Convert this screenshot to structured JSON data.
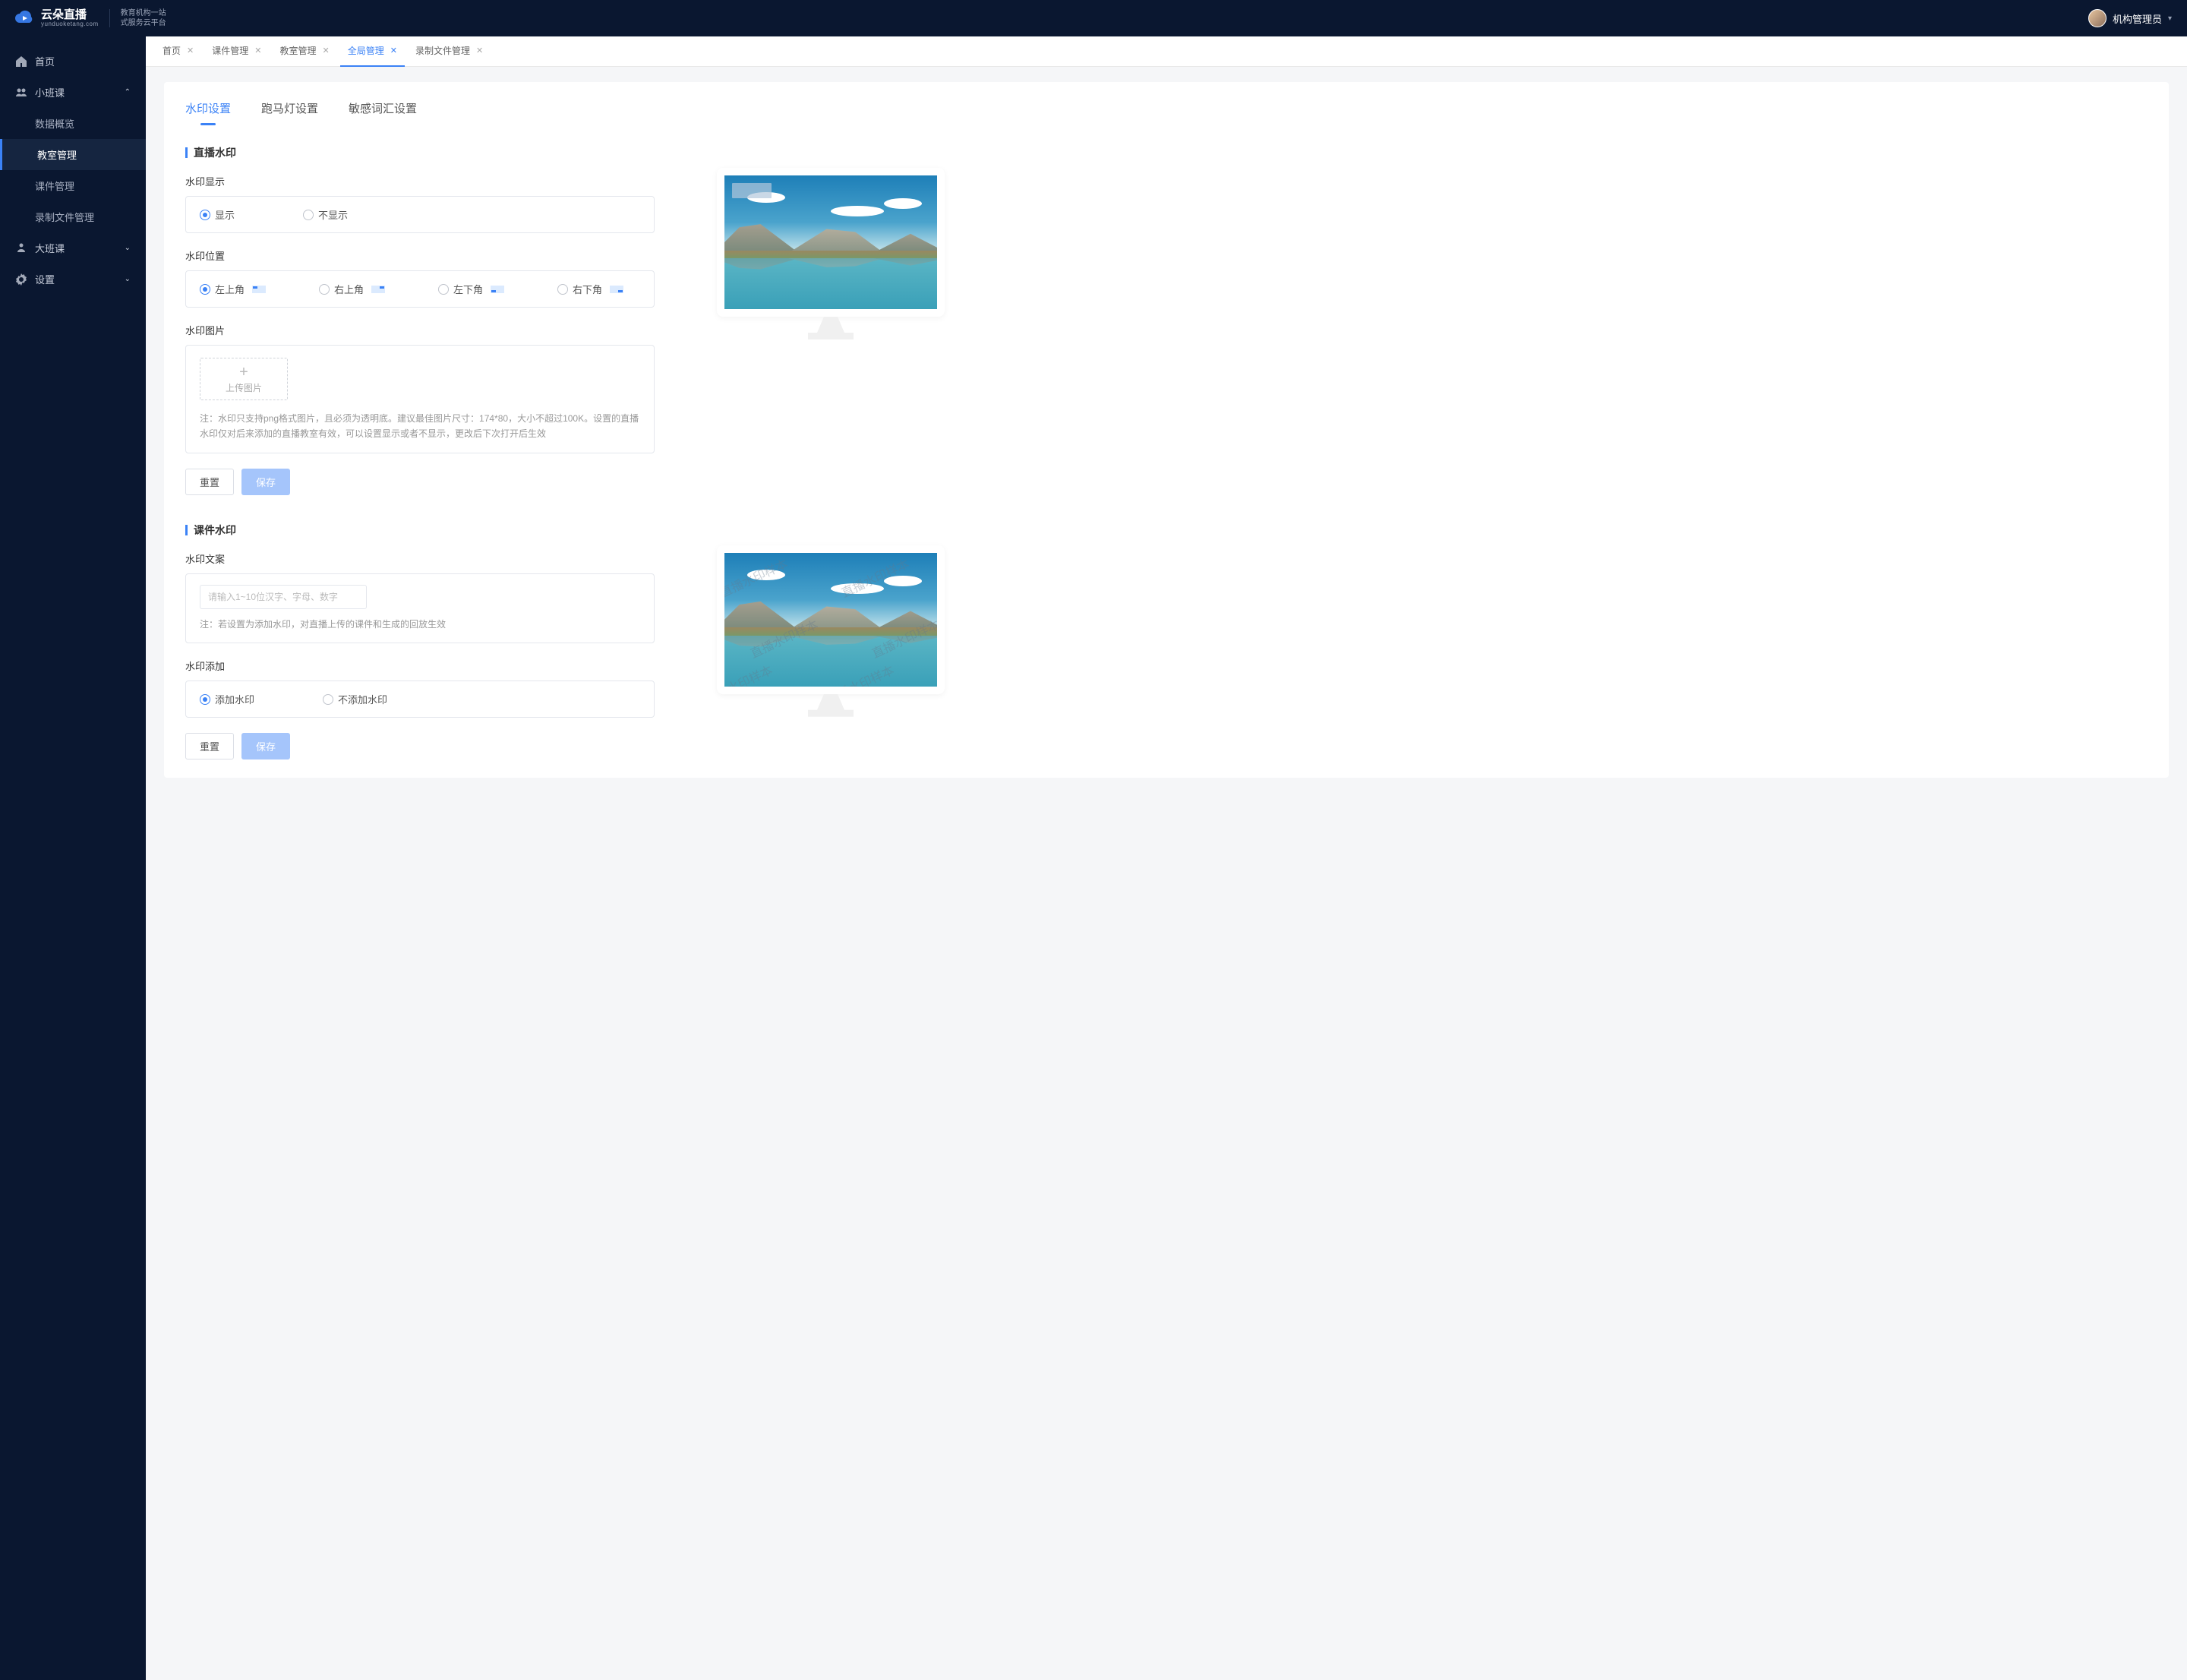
{
  "topbar": {
    "logo_name": "云朵直播",
    "logo_sub": "yunduoketang.com",
    "logo_desc1": "教育机构一站",
    "logo_desc2": "式服务云平台",
    "user_name": "机构管理员"
  },
  "sidebar": {
    "home": "首页",
    "small_class": "小班课",
    "sub": {
      "data_overview": "数据概览",
      "classroom_mgmt": "教室管理",
      "courseware_mgmt": "课件管理",
      "recording_mgmt": "录制文件管理"
    },
    "big_class": "大班课",
    "settings": "设置"
  },
  "tabs": {
    "home": "首页",
    "courseware": "课件管理",
    "classroom": "教室管理",
    "global": "全局管理",
    "recording": "录制文件管理"
  },
  "inner_tabs": {
    "watermark": "水印设置",
    "marquee": "跑马灯设置",
    "sensitive": "敏感词汇设置"
  },
  "sections": {
    "live_wm": "直播水印",
    "course_wm": "课件水印"
  },
  "labels": {
    "wm_display": "水印显示",
    "wm_position": "水印位置",
    "wm_image": "水印图片",
    "wm_text": "水印文案",
    "wm_add": "水印添加"
  },
  "options": {
    "show": "显示",
    "hide": "不显示",
    "tl": "左上角",
    "tr": "右上角",
    "bl": "左下角",
    "br": "右下角",
    "add_wm": "添加水印",
    "no_wm": "不添加水印"
  },
  "upload": {
    "box_text": "上传图片",
    "hint": "注：水印只支持png格式图片，且必须为透明底。建议最佳图片尺寸：174*80，大小不超过100K。设置的直播水印仅对后来添加的直播教室有效，可以设置显示或者不显示，更改后下次打开后生效"
  },
  "course_hint": "注：若设置为添加水印，对直播上传的课件和生成的回放生效",
  "placeholders": {
    "wm_text": "请输入1~10位汉字、字母、数字"
  },
  "buttons": {
    "reset": "重置",
    "save": "保存"
  },
  "preview_sample": "直播水印样本"
}
